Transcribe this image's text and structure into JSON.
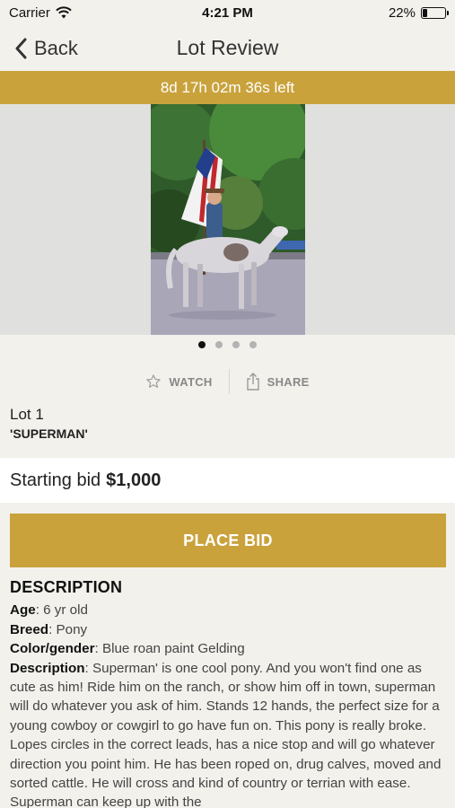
{
  "status_bar": {
    "carrier": "Carrier",
    "time": "4:21 PM",
    "battery": "22%",
    "battery_level": 0.22
  },
  "nav": {
    "back_label": "Back",
    "title": "Lot Review"
  },
  "countdown": "8d 17h 02m 36s left",
  "gallery": {
    "page_count": 4,
    "current_page": 1
  },
  "actions": {
    "watch": "WATCH",
    "share": "SHARE"
  },
  "lot": {
    "number": "Lot 1",
    "name": "'SUPERMAN'"
  },
  "bid": {
    "label": "Starting bid",
    "amount": "$1,000"
  },
  "place_bid_label": "PLACE BID",
  "description": {
    "heading": "DESCRIPTION",
    "age_label": "Age",
    "age": ": 6 yr old",
    "breed_label": "Breed",
    "breed": ": Pony",
    "color_label": "Color/gender",
    "color": ": Blue roan paint Gelding",
    "desc_label": "Description",
    "desc": ": Superman' is one cool pony. And you won't find one as cute as him! Ride him on the ranch, or show him off in town, superman will do whatever you ask of him. Stands 12 hands, the perfect size for a young cowboy or cowgirl to go have fun on. This pony is really broke. Lopes circles in the correct leads, has a nice stop and will go whatever direction you point him. He has been roped on, drug calves, moved and sorted cattle. He will cross and kind of country or terrian with ease. Superman can keep up with the"
  },
  "colors": {
    "accent": "#c9a23c",
    "background": "#f2f1ec"
  }
}
